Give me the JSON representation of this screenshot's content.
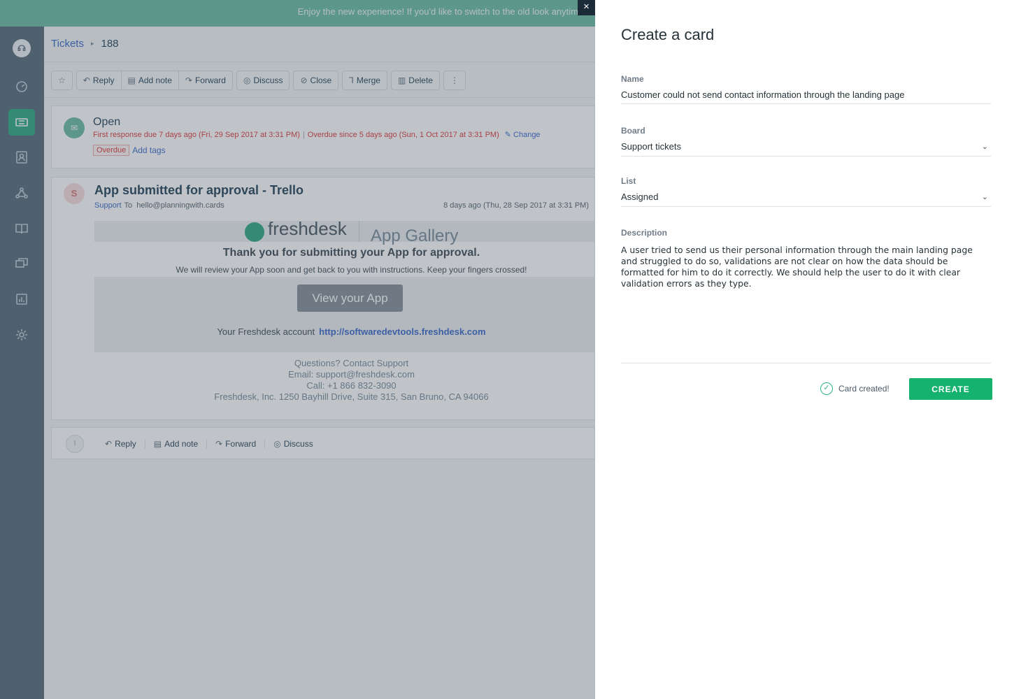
{
  "banner": {
    "text": "Enjoy the new experience! If you'd like to switch to the old look anytim"
  },
  "sidebar": {
    "items": [
      {
        "name": "dashboard-icon"
      },
      {
        "name": "tickets-icon",
        "active": true
      },
      {
        "name": "contacts-icon"
      },
      {
        "name": "groups-icon"
      },
      {
        "name": "solutions-icon"
      },
      {
        "name": "forums-icon"
      },
      {
        "name": "reports-icon"
      },
      {
        "name": "admin-gear-icon"
      }
    ]
  },
  "breadcrumb": {
    "root": "Tickets",
    "separator": "▸",
    "current": "188"
  },
  "toolbar": {
    "star": "☆",
    "reply": "Reply",
    "add_note": "Add note",
    "forward": "Forward",
    "discuss": "Discuss",
    "close": "Close",
    "merge": "Merge",
    "delete": "Delete",
    "more": "⋮"
  },
  "status": {
    "title": "Open",
    "first_response": "First response due 7 days ago (Fri, 29 Sep 2017 at 3:31 PM)",
    "separator": "|",
    "overdue_since": "Overdue since 5 days ago (Sun, 1 Oct 2017 at 3:31 PM)",
    "change": "Change",
    "badge": "Overdue",
    "add_tags": "Add tags"
  },
  "mail": {
    "avatar": "S",
    "subject": "App submitted for approval - Trello",
    "from": "Support",
    "to_label": "To",
    "to": "hello@planningwith.cards",
    "date": "8 days ago (Thu, 28 Sep 2017 at 3:31 PM)",
    "brand": "freshdesk",
    "gallery": "App Gallery",
    "thanks": "Thank you for submitting your App for approval.",
    "review": "We will review your App soon and get back to you with instructions. Keep your fingers crossed!",
    "view_app": "View your App",
    "account_label": "Your Freshdesk account",
    "account_url": "http://softwaredevtools.freshdesk.com",
    "footer": [
      "Questions? Contact Support",
      "Email: support@freshdesk.com",
      "Call: +1 866 832-3090",
      "Freshdesk, Inc. 1250 Bayhill Drive, Suite 315, San Bruno, CA 94066"
    ]
  },
  "reply_bar": {
    "avatar": "I",
    "reply": "Reply",
    "add_note": "Add note",
    "forward": "Forward",
    "discuss": "Discuss"
  },
  "close_label": "×",
  "panel": {
    "title": "Create a card",
    "name_label": "Name",
    "name_value": "Customer could not send contact information through the landing page",
    "board_label": "Board",
    "board_value": "Support tickets",
    "list_label": "List",
    "list_value": "Assigned",
    "description_label": "Description",
    "description_value": "A user tried to send us their personal information through the main landing page and struggled to do so, validations are not clear on how the data should be formatted for him to do it correctly. We should help the user to do it with clear validation errors as they type.",
    "created_text": "Card created!",
    "create_button": "CREATE"
  }
}
